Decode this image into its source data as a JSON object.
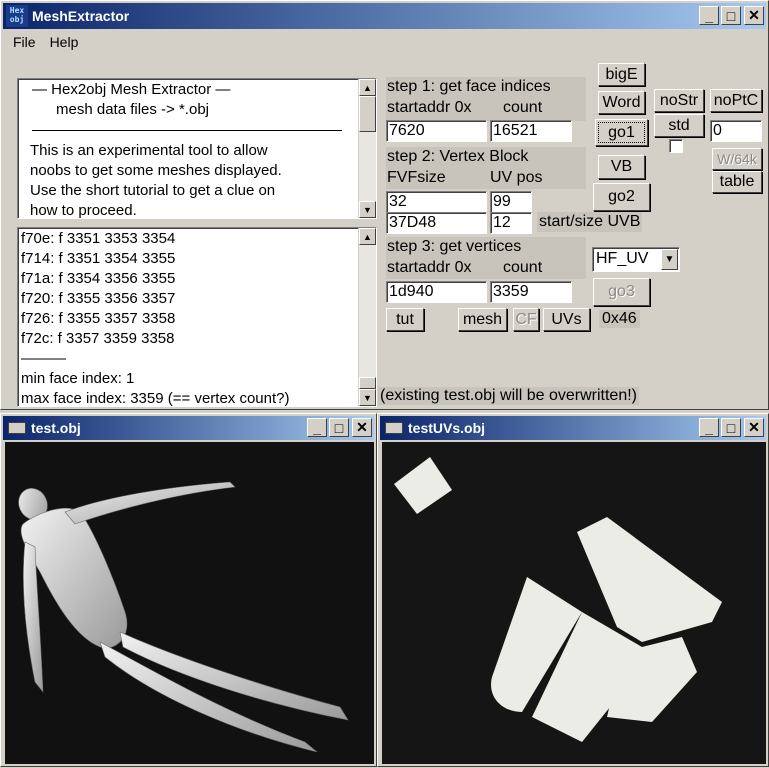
{
  "main": {
    "title": "MeshExtractor",
    "app_icon_text": "Hex obj",
    "menu": [
      {
        "label": "File"
      },
      {
        "label": "Help"
      }
    ]
  },
  "info_box": {
    "lines": [
      "—  Hex2obj Mesh Extractor  —",
      "mesh data files -> *.obj",
      "This is an experimental tool to allow",
      "noobs to get some meshes displayed.",
      "Use the short tutorial to get a clue on",
      "how to proceed."
    ]
  },
  "log_box": {
    "lines": [
      "f70e: f  3351 3353 3354",
      "f714: f  3351 3354 3355",
      "f71a: f  3354 3356 3355",
      "f720: f  3355 3356 3357",
      "f726: f  3355 3357 3358",
      "f72c: f  3357 3359 3358",
      "———",
      "min face index: 1",
      "max face index: 3359 (== vertex count?)"
    ]
  },
  "step1": {
    "label": "step 1: get face indices",
    "startaddr_label": "startaddr 0x",
    "count_label": "count",
    "startaddr": "7620",
    "count": "16521"
  },
  "step2": {
    "label": "step 2: Vertex Block",
    "fvf_label": "FVFsize",
    "uvpos_label": "UV pos",
    "fvfsize": "32",
    "uvpos": "99",
    "uvb_start": "37D48",
    "uvb_size": "12",
    "uvb_label": "start/size UVB"
  },
  "step3": {
    "label": "step 3: get vertices",
    "startaddr_label": "startaddr 0x",
    "count_label": "count",
    "startaddr": "1d940",
    "count": "3359"
  },
  "buttons": {
    "bigE": "bigE",
    "word": "Word",
    "go1": "go1",
    "nostr": "noStr",
    "noptc": "noPtC",
    "std": "std",
    "vb": "VB",
    "w64k": "W/64k",
    "table": "table",
    "go2": "go2",
    "go3": "go3",
    "tut": "tut",
    "mesh": "mesh",
    "cf": "CF",
    "uvs": "UVs"
  },
  "noptc_value": "0",
  "format_select": "HF_UV",
  "hex_readout": "0x46",
  "warning": "(existing test.obj will be overwritten!)",
  "win_obj": {
    "title": "test.obj"
  },
  "win_uv": {
    "title": "testUVs.obj"
  }
}
